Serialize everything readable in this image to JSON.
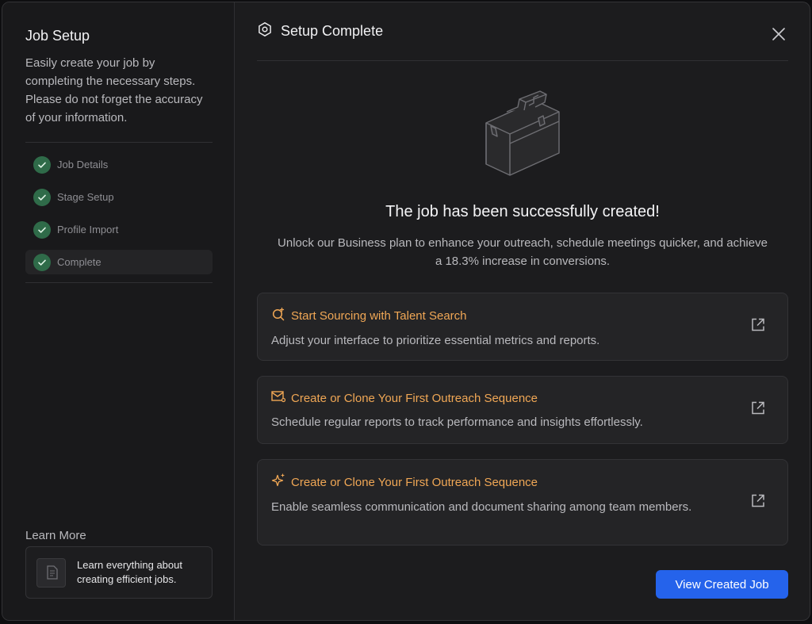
{
  "sidebar": {
    "title": "Job Setup",
    "description": "Easily create your job by completing the necessary steps. Please do not forget the accuracy of your information.",
    "steps": [
      {
        "label": "Job Details",
        "status": "complete"
      },
      {
        "label": "Stage Setup",
        "status": "complete"
      },
      {
        "label": "Profile Import",
        "status": "complete"
      },
      {
        "label": "Complete",
        "status": "complete",
        "active": true
      }
    ],
    "learn_more": {
      "title": "Learn More",
      "card_text": "Learn everything about creating efficient jobs."
    }
  },
  "header": {
    "icon": "hexagon-gear-icon",
    "title": "Setup Complete",
    "close_icon": "close-icon"
  },
  "hero": {
    "icon": "briefcase-icon",
    "title": "The job has been successfully created!",
    "description": "Unlock our Business plan to enhance your outreach, schedule meetings quicker, and achieve a 18.3% increase in conversions."
  },
  "cards": [
    {
      "icon": "search-sparkle-icon",
      "title": "Start Sourcing with Talent Search",
      "description": "Adjust your interface to prioritize essential metrics and reports."
    },
    {
      "icon": "mail-icon",
      "title": "Create or Clone Your First Outreach Sequence",
      "description": "Schedule regular reports to track performance and insights effortlessly."
    },
    {
      "icon": "sparkle-icon",
      "title": "Create or Clone Your First Outreach Sequence",
      "description": "Enable seamless communication and document sharing among team members."
    }
  ],
  "actions": {
    "primary_label": "View Created Job"
  },
  "colors": {
    "accent": "#2563eb",
    "card_title": "#f0a755",
    "check": "#2f6b49"
  }
}
